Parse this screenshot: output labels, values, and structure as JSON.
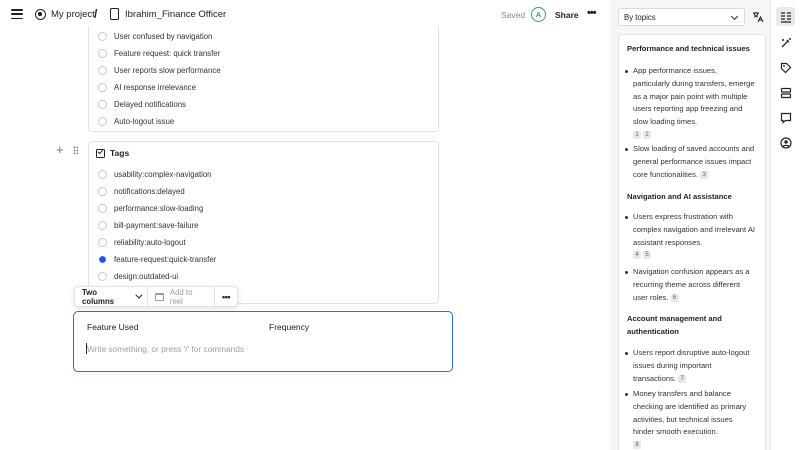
{
  "topbar": {
    "project": "My project",
    "separator": "/",
    "document": "Ibrahim_Finance Officer",
    "saved": "Saved",
    "avatar_initial": "A",
    "share": "Share",
    "more": "•••"
  },
  "card1": {
    "options": [
      {
        "label": "User confused by navigation",
        "selected": false
      },
      {
        "label": "Feature request: quick transfer",
        "selected": false
      },
      {
        "label": "User reports slow performance",
        "selected": false
      },
      {
        "label": "AI response irrelevance",
        "selected": false
      },
      {
        "label": "Delayed notifications",
        "selected": false
      },
      {
        "label": "Auto-logout issue",
        "selected": false
      }
    ]
  },
  "tags": {
    "title": "Tags",
    "options": [
      {
        "label": "usability:complex-navigation",
        "selected": false
      },
      {
        "label": "notifications:delayed",
        "selected": false
      },
      {
        "label": "performance:slow-loading",
        "selected": false
      },
      {
        "label": "bill-payment:save-failure",
        "selected": false
      },
      {
        "label": "reliability:auto-logout",
        "selected": false
      },
      {
        "label": "feature-request:quick-transfer",
        "selected": true
      },
      {
        "label": "design:outdated-ui",
        "selected": false
      }
    ]
  },
  "toolbar": {
    "columns": "Two columns",
    "add_to_reel": "Add to reel",
    "more": "•••"
  },
  "editor": {
    "col1": "Feature Used",
    "col2": "Frequency",
    "placeholder": "Write something, or press '/' for commands"
  },
  "panel": {
    "group_by": "By topics",
    "sections": [
      {
        "title": "Performance and technical issues",
        "bullets": [
          {
            "text": "App performance issues, particularly during transfers, emerge as a major pain point with multiple users reporting app freezing and slow loading times.",
            "cites": [
              "1",
              "2"
            ]
          },
          {
            "text": "Slow loading of saved accounts and general performance issues impact core functionalities.",
            "cites": [
              "3"
            ]
          }
        ]
      },
      {
        "title": "Navigation and AI assistance",
        "bullets": [
          {
            "text": "Users express frustration with complex navigation and irrelevant AI assistant responses.",
            "cites": [
              "4",
              "5"
            ]
          },
          {
            "text": "Navigation confusion appears as a recurring theme across different user roles.",
            "cites": [
              "6"
            ]
          }
        ]
      },
      {
        "title": "Account management and authentication",
        "bullets": [
          {
            "text": "Users report disruptive auto-logout issues during important transactions.",
            "cites": [
              "7"
            ]
          },
          {
            "text": "Money transfers and balance checking are identified as primary activities, but technical issues hinder smooth execution.",
            "cites": [
              "8"
            ]
          }
        ]
      }
    ]
  },
  "rail": {
    "icons": [
      "insights-icon",
      "magic-edit-icon",
      "tag-icon",
      "list-icon",
      "comment-icon",
      "user-icon"
    ]
  },
  "colors": {
    "accent": "#2f6ae0",
    "selected_radio": "#2255d9",
    "avatar": "#3a9d5d"
  }
}
